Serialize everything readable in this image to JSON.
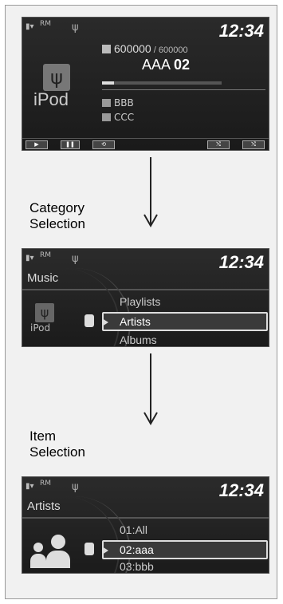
{
  "status": {
    "signal": "RM",
    "clock": "12:34"
  },
  "now_playing": {
    "track_current": "600000",
    "track_sep": " / ",
    "track_total": "600000",
    "song_prefix": "AAA ",
    "song_num": "02",
    "source_label": "iPod",
    "progress": 0.1,
    "artist": "BBB",
    "album": "CCC",
    "controls": [
      "play",
      "pause",
      "repeat",
      "shuffle",
      "shuffle-all"
    ]
  },
  "step1_label": {
    "line1": "Category",
    "line2": "Selection"
  },
  "category_screen": {
    "title": "Music",
    "source_label": "iPod",
    "items": [
      "Playlists",
      "Artists",
      "Albums"
    ],
    "selected": "Artists"
  },
  "step2_label": {
    "line1": "Item",
    "line2": "Selection"
  },
  "item_screen": {
    "title": "Artists",
    "items": [
      "01:All",
      "02:aaa",
      "03:bbb"
    ],
    "selected": "02:aaa"
  }
}
